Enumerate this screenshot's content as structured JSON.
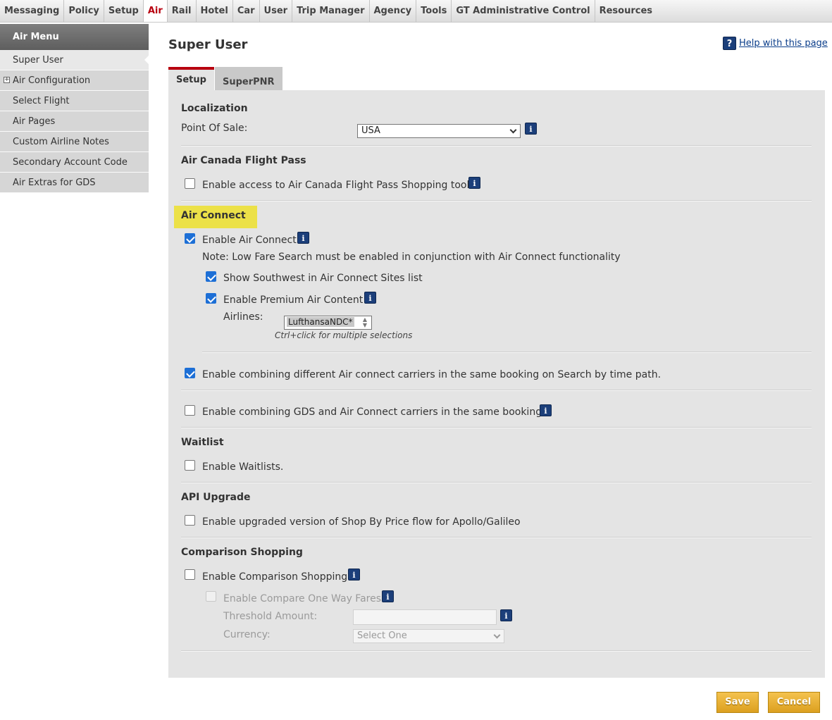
{
  "topnav": [
    "Messaging",
    "Policy",
    "Setup",
    "Air",
    "Rail",
    "Hotel",
    "Car",
    "User",
    "Trip Manager",
    "Agency",
    "Tools",
    "GT Administrative Control",
    "Resources"
  ],
  "topnav_active": "Air",
  "sidebar": {
    "header": "Air Menu",
    "items": [
      "Super User",
      "Air Configuration",
      "Select Flight",
      "Air Pages",
      "Custom Airline Notes",
      "Secondary Account Code",
      "Air Extras for GDS"
    ]
  },
  "page_title": "Super User",
  "help_label": "Help with this page",
  "tabs": [
    "Setup",
    "SuperPNR"
  ],
  "localization": {
    "title": "Localization",
    "pos_label": "Point Of Sale:",
    "pos_value": "USA"
  },
  "air_canada": {
    "title": "Air Canada Flight Pass",
    "enable_label": "Enable access to Air Canada Flight Pass Shopping tool",
    "checked": false
  },
  "air_connect": {
    "title": "Air Connect",
    "enable_label": "Enable Air Connect",
    "enable_checked": true,
    "note": "Note: Low Fare Search must be enabled in conjunction with Air Connect functionality",
    "southwest_label": "Show Southwest in Air Connect Sites list",
    "southwest_checked": true,
    "premium_label": "Enable Premium Air Content",
    "premium_checked": true,
    "airlines_label": "Airlines:",
    "airlines_value": "LufthansaNDC*",
    "ctrl_hint": "Ctrl+click for multiple selections",
    "combine_label": "Enable combining different Air connect carriers in the same booking on Search by time path.",
    "combine_checked": true,
    "gds_label": "Enable combining GDS and Air Connect carriers in the same booking",
    "gds_checked": false
  },
  "waitlist": {
    "title": "Waitlist",
    "label": "Enable Waitlists.",
    "checked": false
  },
  "api_upgrade": {
    "title": "API Upgrade",
    "label": "Enable upgraded version of Shop By Price flow for Apollo/Galileo",
    "checked": false
  },
  "comparison": {
    "title": "Comparison Shopping",
    "enable_label": "Enable Comparison Shopping",
    "enable_checked": false,
    "oneway_label": "Enable Compare One Way Fares",
    "threshold_label": "Threshold Amount:",
    "threshold_value": "",
    "currency_label": "Currency:",
    "currency_value": "Select One"
  },
  "buttons": {
    "save": "Save",
    "cancel": "Cancel"
  },
  "colors": {
    "accent_red": "#b8000f",
    "highlight": "#ece148",
    "button": "#dca020",
    "info_icon": "#1c3f7a"
  }
}
